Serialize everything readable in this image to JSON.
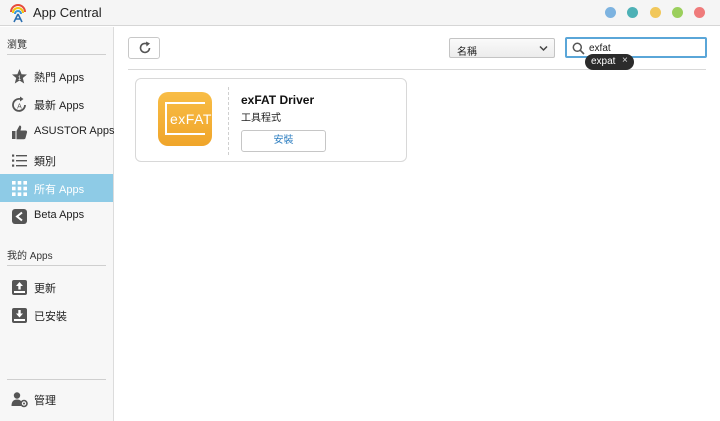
{
  "window": {
    "title": "App Central",
    "dots": [
      "#7db3e0",
      "#4db1b6",
      "#f1c75a",
      "#9bcf5c",
      "#ef7b7b"
    ]
  },
  "sidebar": {
    "browse_label": "瀏覽",
    "my_apps_label": "我的 Apps",
    "items": [
      {
        "label": "熱門 Apps",
        "icon": "star-icon"
      },
      {
        "label": "最新 Apps",
        "icon": "new-icon"
      },
      {
        "label": "ASUSTOR Apps",
        "icon": "thumbs-up-icon"
      },
      {
        "label": "類別",
        "icon": "list-icon"
      },
      {
        "label": "所有 Apps",
        "icon": "grid-icon",
        "active": true
      },
      {
        "label": "Beta Apps",
        "icon": "beta-icon"
      }
    ],
    "my_items": [
      {
        "label": "更新",
        "icon": "update-icon"
      },
      {
        "label": "已安裝",
        "icon": "installed-icon"
      }
    ],
    "manage_label": "管理"
  },
  "toolbar": {
    "sort_value": "名稱",
    "search_value": "exfat",
    "suggestion": "expat",
    "suggestion_close": "×"
  },
  "apps": [
    {
      "name": "exFAT Driver",
      "category": "工具程式",
      "icon_text": "exFAT",
      "action_label": "安裝",
      "icon_color": "#f5b13a"
    }
  ]
}
